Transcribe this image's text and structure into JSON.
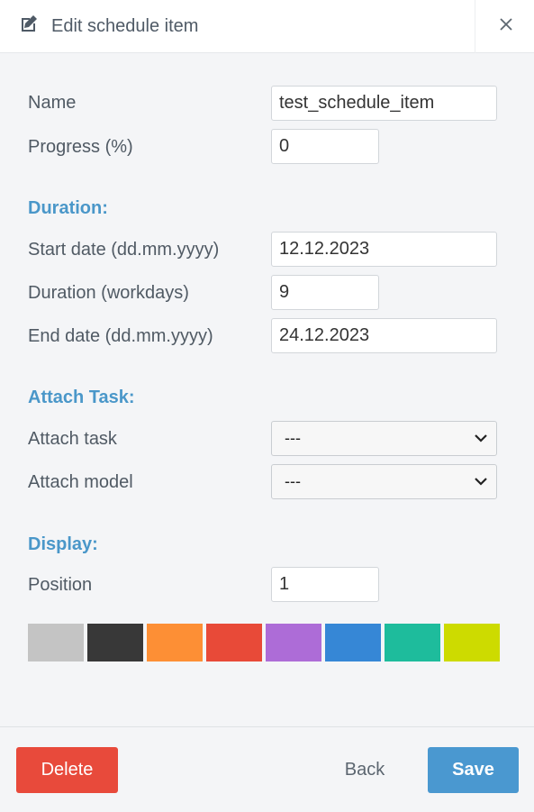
{
  "header": {
    "title": "Edit schedule item",
    "edit_icon": "edit-icon",
    "close_icon": "close-icon"
  },
  "fields": {
    "name": {
      "label": "Name",
      "value": "test_schedule_item"
    },
    "progress": {
      "label": "Progress (%)",
      "value": "0"
    }
  },
  "duration": {
    "heading": "Duration:",
    "start": {
      "label": "Start date (dd.mm.yyyy)",
      "value": "12.12.2023"
    },
    "workdays": {
      "label": "Duration (workdays)",
      "value": "9"
    },
    "end": {
      "label": "End date (dd.mm.yyyy)",
      "value": "24.12.2023"
    }
  },
  "attach": {
    "heading": "Attach Task:",
    "task": {
      "label": "Attach task",
      "value": "---"
    },
    "model": {
      "label": "Attach model",
      "value": "---"
    }
  },
  "display": {
    "heading": "Display:",
    "position": {
      "label": "Position",
      "value": "1"
    },
    "colors": [
      "#c4c4c4",
      "#383838",
      "#fd8f35",
      "#e84a38",
      "#ad6cd7",
      "#3687d6",
      "#1ebc9c",
      "#cddb00"
    ]
  },
  "footer": {
    "delete_label": "Delete",
    "back_label": "Back",
    "save_label": "Save"
  }
}
